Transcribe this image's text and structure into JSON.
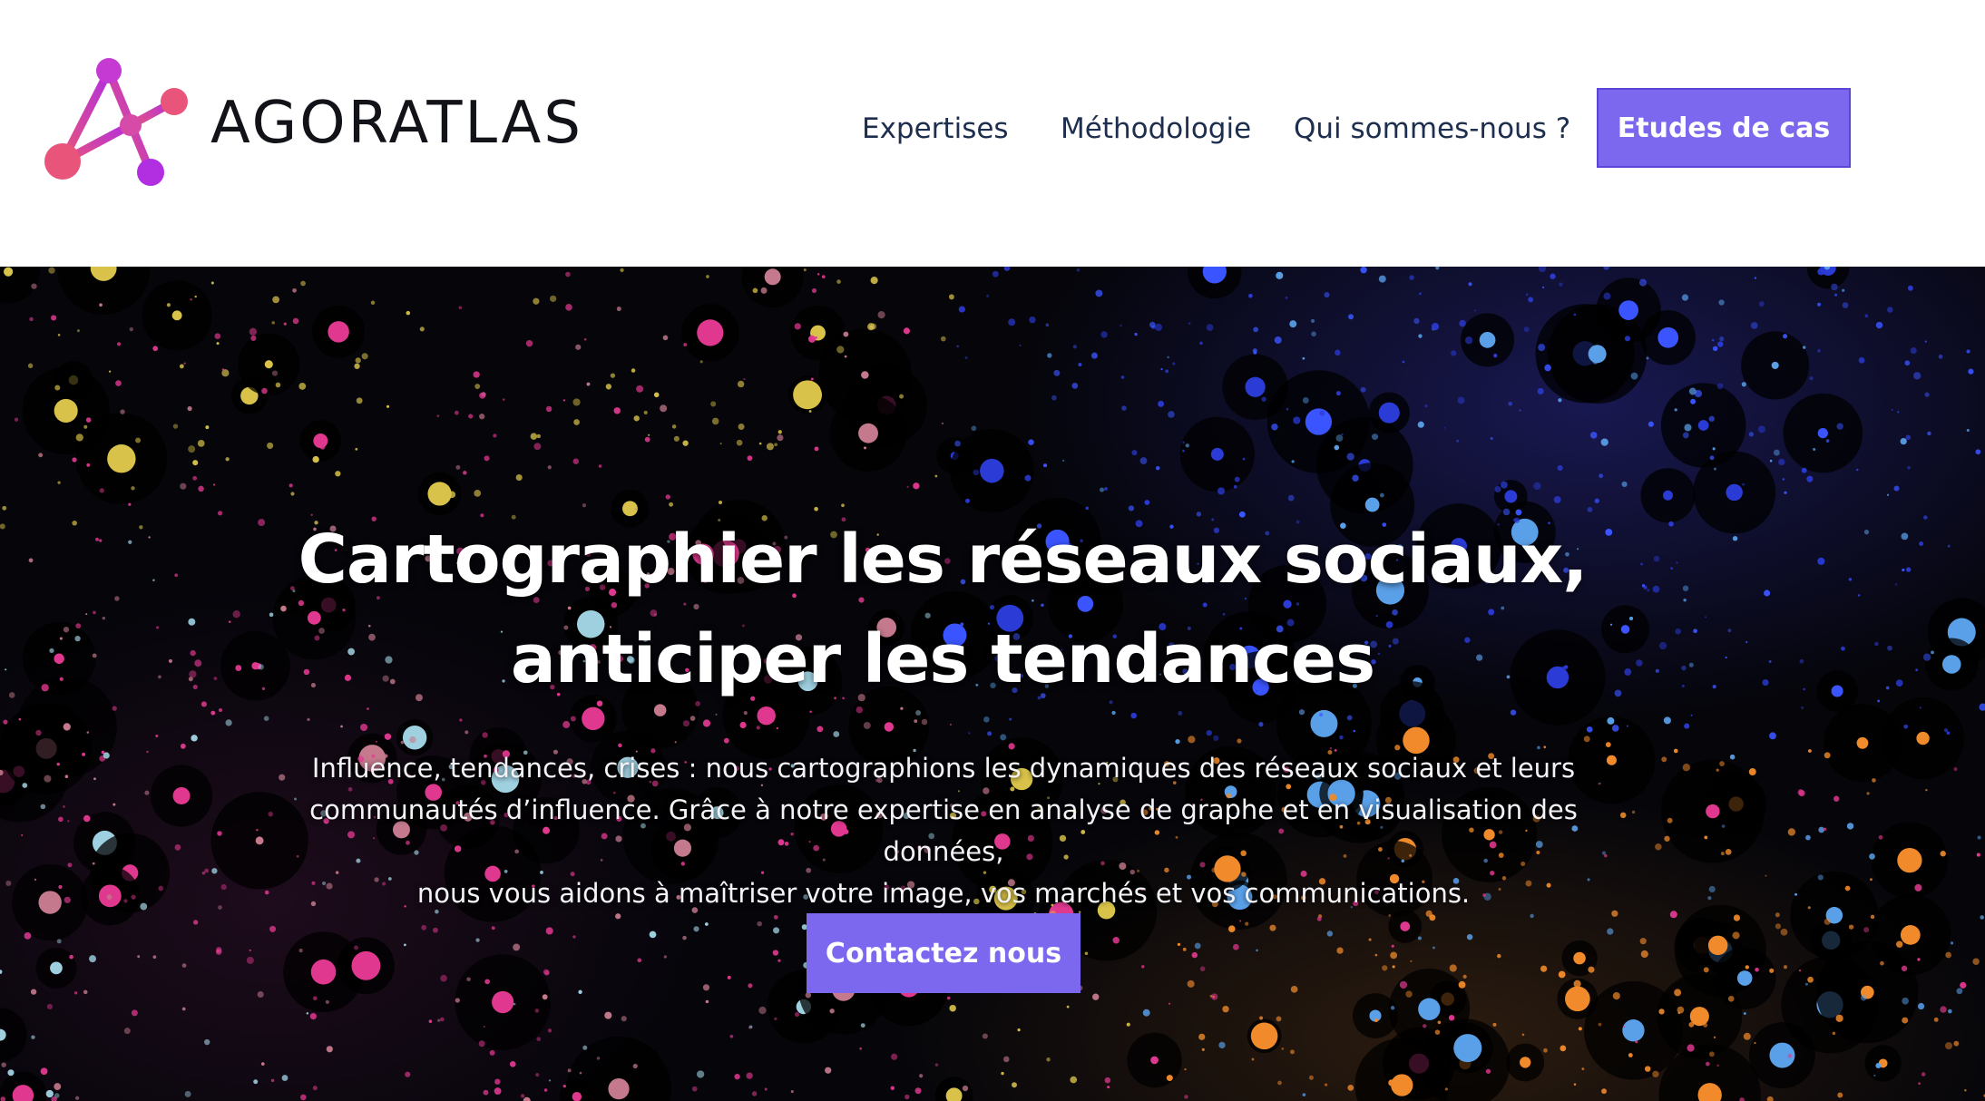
{
  "brand": {
    "name": "AGORATLAS",
    "logo_icon": "network-a-logo-icon"
  },
  "nav": {
    "links": [
      {
        "label": "Expertises"
      },
      {
        "label": "Méthodologie"
      },
      {
        "label": "Qui sommes-nous ?"
      }
    ],
    "cta_label": "Etudes de cas"
  },
  "hero": {
    "title_line1": "Cartographier les réseaux sociaux,",
    "title_line2": "anticiper les tendances",
    "text_line1": "Influence, tendances, crises : nous cartographions les dynamiques des réseaux sociaux et leurs",
    "text_line2": "communautés d’influence. Grâce à notre expertise en analyse de graphe et en visualisation des données,",
    "text_line3": "nous vous aidons à maîtriser votre image, vos marchés et vos communications.",
    "cta_label": "Contactez nous",
    "background": "network-graph-background"
  },
  "colors": {
    "accent": "#7b68ee",
    "nav_text": "#1d2e4e",
    "logo_gradient_start": "#e9547a",
    "logo_gradient_end": "#b12fe0",
    "dot_palette": [
      "#2b3bd6",
      "#3a55ff",
      "#e0388f",
      "#f08a2b",
      "#d8c24a",
      "#9fd0e0",
      "#5aa0e8",
      "#c47a8c"
    ]
  }
}
